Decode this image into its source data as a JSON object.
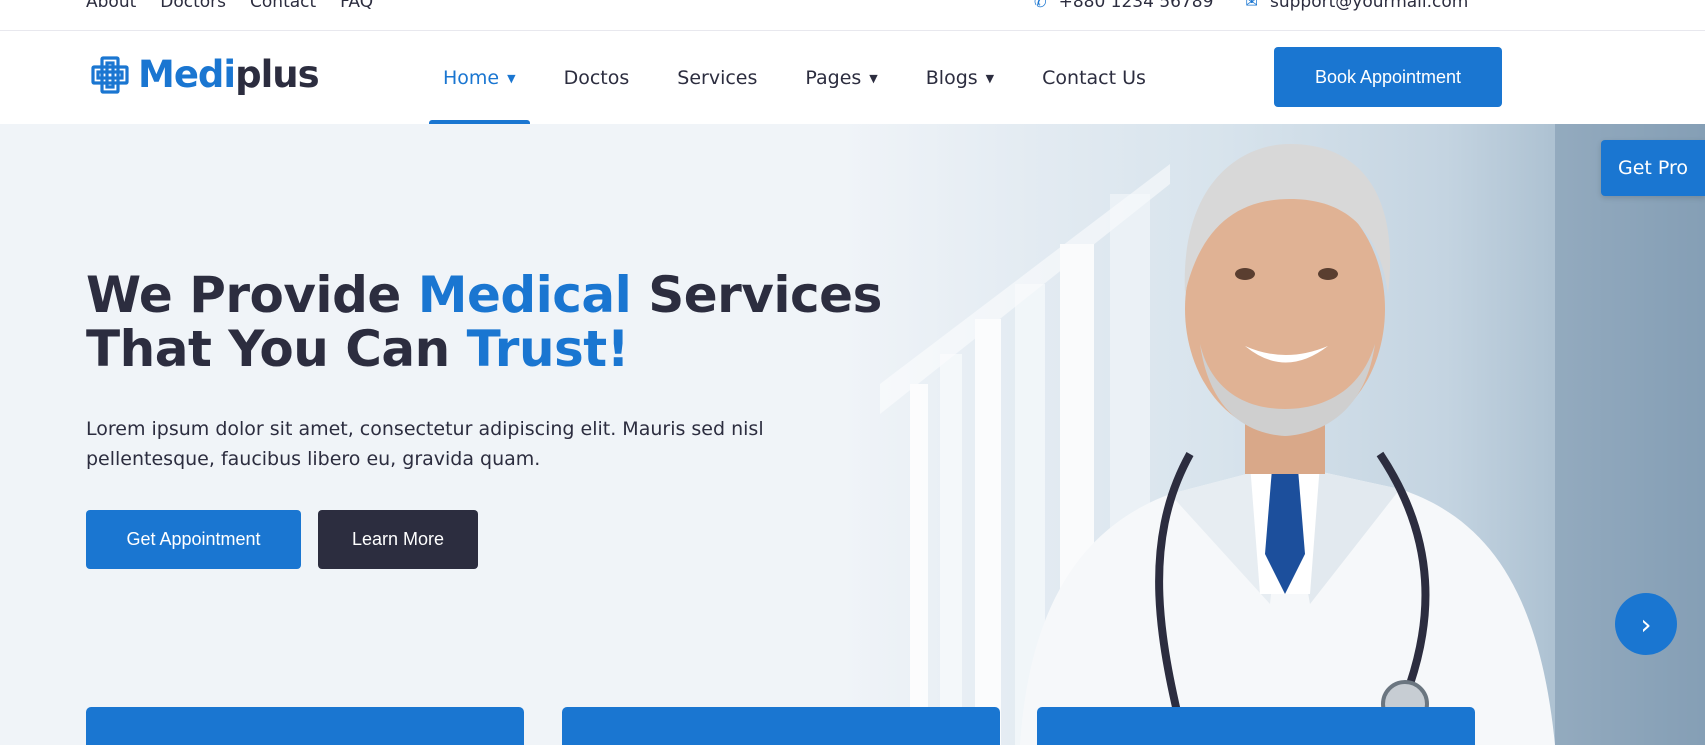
{
  "topbar": {
    "links": [
      "About",
      "Doctors",
      "Contact",
      "FAQ"
    ],
    "phone": "+880 1234 56789",
    "email": "support@yourmail.com"
  },
  "brand": {
    "part1": "Medi",
    "part2": "plus"
  },
  "nav": {
    "items": [
      {
        "label": "Home",
        "has_dropdown": true,
        "active": true
      },
      {
        "label": "Doctos",
        "has_dropdown": false
      },
      {
        "label": "Services",
        "has_dropdown": false
      },
      {
        "label": "Pages",
        "has_dropdown": true
      },
      {
        "label": "Blogs",
        "has_dropdown": true
      },
      {
        "label": "Contact Us",
        "has_dropdown": false
      }
    ],
    "book_button": "Book Appointment"
  },
  "hero": {
    "title_part1": "We Provide ",
    "title_highlight1": "Medical",
    "title_part2": " Services",
    "title_part3": "That You Can ",
    "title_highlight2": "Trust!",
    "description": "Lorem ipsum dolor sit amet, consectetur adipiscing elit. Mauris sed nisl pellentesque, faucibus libero eu, gravida quam.",
    "primary_button": "Get Appointment",
    "secondary_button": "Learn More"
  },
  "get_pro": "Get Pro",
  "colors": {
    "accent": "#1a76d1",
    "dark": "#2c2d3f",
    "hero_bg": "#f0f4f8"
  },
  "icons": {
    "phone": "phone-icon",
    "email": "email-icon",
    "next": "chevron-right-icon",
    "dropdown": "chevron-down-icon"
  }
}
